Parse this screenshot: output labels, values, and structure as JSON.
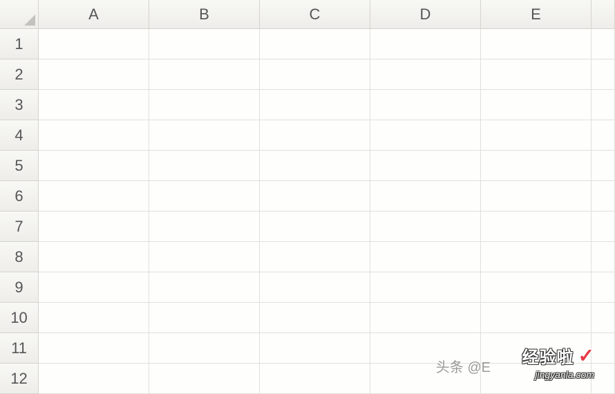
{
  "columns": [
    "A",
    "B",
    "C",
    "D",
    "E",
    ""
  ],
  "rows": [
    "1",
    "2",
    "3",
    "4",
    "5",
    "6",
    "7",
    "8",
    "9",
    "10",
    "11",
    "12"
  ],
  "watermark": {
    "prefix": "头条 @E",
    "main": "经验啦",
    "url": "jingyanla.com"
  }
}
